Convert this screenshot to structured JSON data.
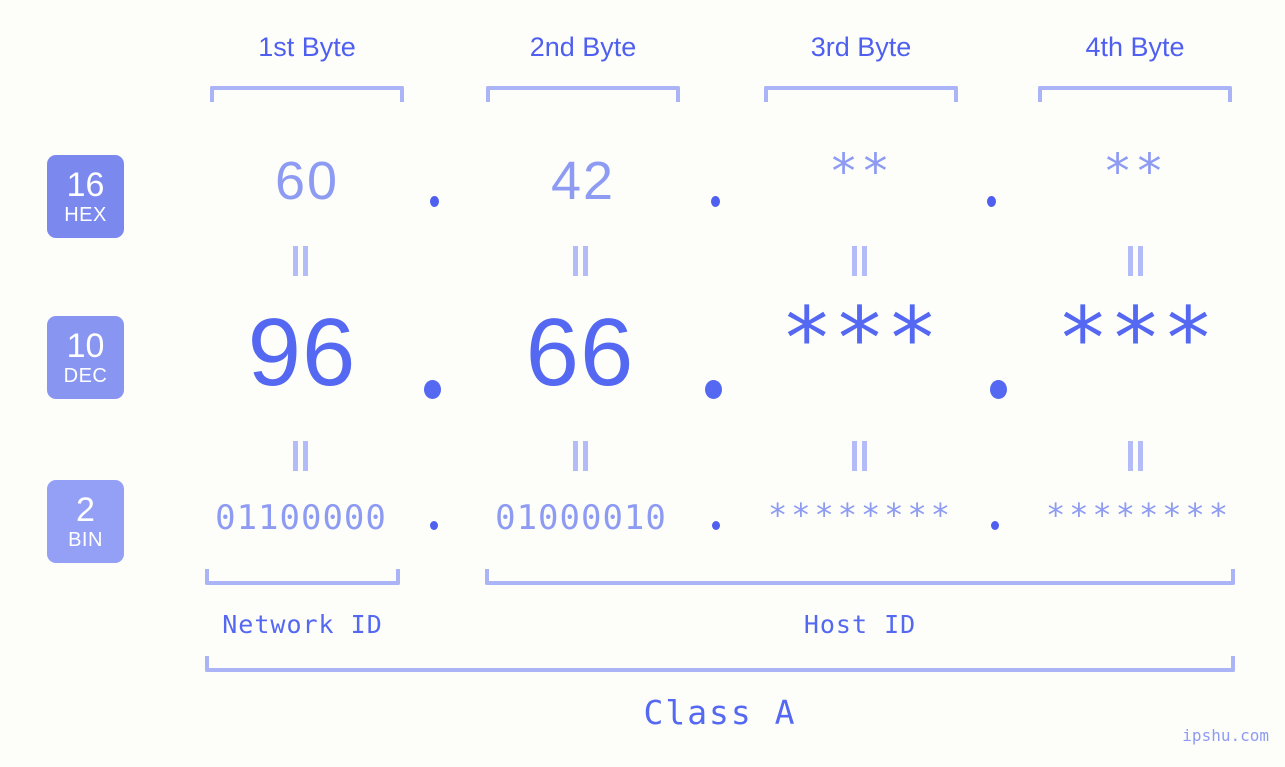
{
  "watermark": "ipshu.com",
  "byte_headers": [
    {
      "label": "1st Byte"
    },
    {
      "label": "2nd Byte"
    },
    {
      "label": "3rd Byte"
    },
    {
      "label": "4th Byte"
    }
  ],
  "bases": [
    {
      "number": "16",
      "name": "HEX",
      "color": "#7b89ee"
    },
    {
      "number": "10",
      "name": "DEC",
      "color": "#8895f1"
    },
    {
      "number": "2",
      "name": "BIN",
      "color": "#93a0f5"
    }
  ],
  "rows": {
    "hex": {
      "base_number": "16",
      "base_name": "HEX",
      "values": [
        "60",
        "42",
        "**",
        "**"
      ],
      "separator": "."
    },
    "dec": {
      "base_number": "10",
      "base_name": "DEC",
      "values": [
        "96",
        "66",
        "***",
        "***"
      ],
      "separator": "."
    },
    "bin": {
      "base_number": "2",
      "base_name": "BIN",
      "values": [
        "01100000",
        "01000010",
        "********",
        "********"
      ],
      "separator": "."
    }
  },
  "equals_separator": "=",
  "segments": {
    "network_id": "Network ID",
    "host_id": "Host ID",
    "class": "Class A"
  },
  "colors": {
    "background": "#fdfefa",
    "accent_strong": "#4f5ff0",
    "accent_mid": "#5468f2",
    "accent_light": "#8e9bf2",
    "bracket": "#aab4f7",
    "badge_hex": "#7b89ee",
    "badge_dec": "#8895f1",
    "badge_bin": "#93a0f5"
  }
}
